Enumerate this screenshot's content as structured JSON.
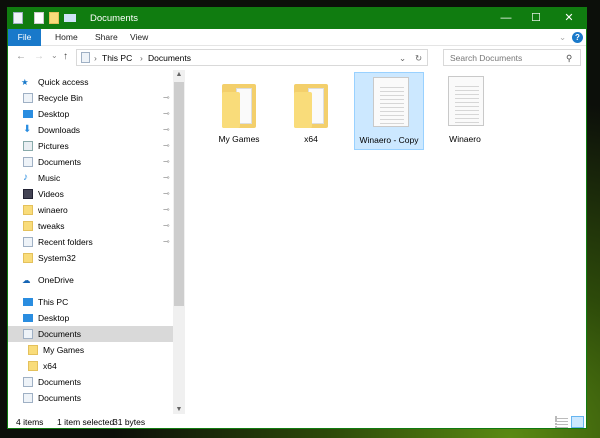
{
  "window": {
    "title": "Documents",
    "minimize": "—",
    "maximize": "☐",
    "close": "✕"
  },
  "ribbon": {
    "tabs": [
      "File",
      "Home",
      "Share",
      "View"
    ],
    "expand": "⌄",
    "help": "?"
  },
  "nav": {
    "back": "←",
    "forward": "→",
    "recent": "⌄",
    "up": "↑",
    "breadcrumb": [
      "This PC",
      "Documents"
    ],
    "sep": "›",
    "dropdown": "⌄",
    "refresh": "↻",
    "search_placeholder": "Search Documents",
    "search_icon": "⚲"
  },
  "sidebar": {
    "quick_access": "Quick access",
    "items": [
      {
        "label": "Recycle Bin",
        "icon": "recycle-bin",
        "pinned": true
      },
      {
        "label": "Desktop",
        "icon": "desktop",
        "pinned": true
      },
      {
        "label": "Downloads",
        "icon": "downloads",
        "pinned": true
      },
      {
        "label": "Pictures",
        "icon": "pictures",
        "pinned": true
      },
      {
        "label": "Documents",
        "icon": "documents",
        "pinned": true
      },
      {
        "label": "Music",
        "icon": "music",
        "pinned": true
      },
      {
        "label": "Videos",
        "icon": "videos",
        "pinned": true
      },
      {
        "label": "winaero",
        "icon": "folder",
        "pinned": true
      },
      {
        "label": "tweaks",
        "icon": "folder",
        "pinned": true
      },
      {
        "label": "Recent folders",
        "icon": "recent",
        "pinned": true
      },
      {
        "label": "System32",
        "icon": "folder",
        "pinned": false
      }
    ],
    "onedrive": "OneDrive",
    "this_pc": "This PC",
    "pc_items": [
      {
        "label": "Desktop",
        "icon": "desktop",
        "level": 1
      },
      {
        "label": "Documents",
        "icon": "documents",
        "level": 1,
        "selected": true
      },
      {
        "label": "My Games",
        "icon": "folder",
        "level": 2
      },
      {
        "label": "x64",
        "icon": "folder",
        "level": 2
      },
      {
        "label": "Documents",
        "icon": "documents",
        "level": 1
      },
      {
        "label": "Documents",
        "icon": "documents",
        "level": 1
      }
    ],
    "pin_glyph": "📌"
  },
  "files": [
    {
      "name": "My Games",
      "type": "folder"
    },
    {
      "name": "x64",
      "type": "folder"
    },
    {
      "name": "Winaero - Copy",
      "type": "file",
      "selected": true
    },
    {
      "name": "Winaero",
      "type": "file"
    }
  ],
  "status": {
    "count": "4 items",
    "selection": "1 item selected",
    "size": "31 bytes"
  },
  "colors": {
    "titlebar": "#107c10",
    "accent": "#1979ca",
    "selection": "#cce8ff"
  }
}
